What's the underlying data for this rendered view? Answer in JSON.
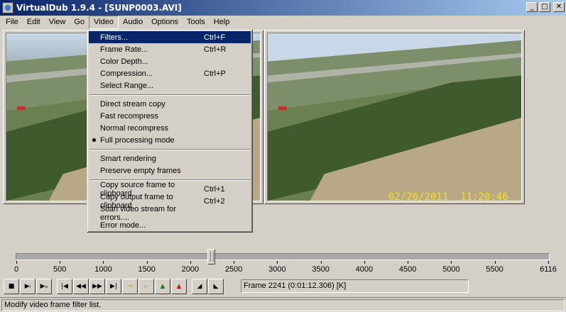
{
  "window": {
    "title": "VirtualDub 1.9.4 - [SUNP0003.AVI]",
    "minimize": "_",
    "maximize": "□",
    "close": "✕"
  },
  "menubar": [
    "File",
    "Edit",
    "View",
    "Go",
    "Video",
    "Audio",
    "Options",
    "Tools",
    "Help"
  ],
  "video_menu": {
    "groups": [
      [
        {
          "label": "Filters...",
          "shortcut": "Ctrl+F",
          "selected": true
        },
        {
          "label": "Frame Rate...",
          "shortcut": "Ctrl+R"
        },
        {
          "label": "Color Depth...",
          "shortcut": ""
        },
        {
          "label": "Compression...",
          "shortcut": "Ctrl+P"
        },
        {
          "label": "Select Range...",
          "shortcut": ""
        }
      ],
      [
        {
          "label": "Direct stream copy",
          "shortcut": ""
        },
        {
          "label": "Fast recompress",
          "shortcut": ""
        },
        {
          "label": "Normal recompress",
          "shortcut": ""
        },
        {
          "label": "Full processing mode",
          "shortcut": "",
          "checked": true
        }
      ],
      [
        {
          "label": "Smart rendering",
          "shortcut": ""
        },
        {
          "label": "Preserve empty frames",
          "shortcut": ""
        }
      ],
      [
        {
          "label": "Copy source frame to clipboard",
          "shortcut": "Ctrl+1"
        },
        {
          "label": "Copy output frame to clipboard",
          "shortcut": "Ctrl+2"
        },
        {
          "label": "Scan video stream for errors....",
          "shortcut": ""
        },
        {
          "label": "Error mode...",
          "shortcut": ""
        }
      ]
    ]
  },
  "output_timestamp": "02/26/2011  11:20:46",
  "timeline": {
    "ticks": [
      "0",
      "500",
      "1000",
      "1500",
      "2000",
      "2500",
      "3000",
      "3500",
      "4000",
      "4500",
      "5000",
      "5500",
      "6116"
    ],
    "tick_values": [
      0,
      500,
      1000,
      1500,
      2000,
      2500,
      3000,
      3500,
      4000,
      4500,
      5000,
      5500,
      6116
    ],
    "max": 6116,
    "position": 2241
  },
  "toolbar": {
    "buttons": [
      {
        "name": "stop-button",
        "icon": "stop-icon",
        "glyph": "■"
      },
      {
        "name": "play-input-button",
        "icon": "play-input-icon",
        "glyph": "▶ᵢ"
      },
      {
        "name": "play-output-button",
        "icon": "play-output-icon",
        "glyph": "▶ₒ"
      },
      {
        "name": "go-start-button",
        "icon": "go-start-icon",
        "glyph": "|◀"
      },
      {
        "name": "step-back-button",
        "icon": "step-back-icon",
        "glyph": "◀◀"
      },
      {
        "name": "step-forward-button",
        "icon": "step-forward-icon",
        "glyph": "▶▶"
      },
      {
        "name": "go-end-button",
        "icon": "go-end-icon",
        "glyph": "▶|"
      },
      {
        "name": "prev-keyframe-button",
        "icon": "prev-keyframe-icon",
        "glyph": "🔑"
      },
      {
        "name": "next-keyframe-button",
        "icon": "next-keyframe-icon",
        "glyph": "🔑"
      },
      {
        "name": "prev-scene-button",
        "icon": "prev-scene-icon",
        "glyph": "▲"
      },
      {
        "name": "next-scene-button",
        "icon": "next-scene-icon",
        "glyph": "▲"
      },
      {
        "name": "mark-in-button",
        "icon": "mark-in-icon",
        "glyph": "◢"
      },
      {
        "name": "mark-out-button",
        "icon": "mark-out-icon",
        "glyph": "◣"
      }
    ]
  },
  "frame_field": "Frame 2241 (0:01:12.306) [K]",
  "status": "Modify video frame filter list."
}
